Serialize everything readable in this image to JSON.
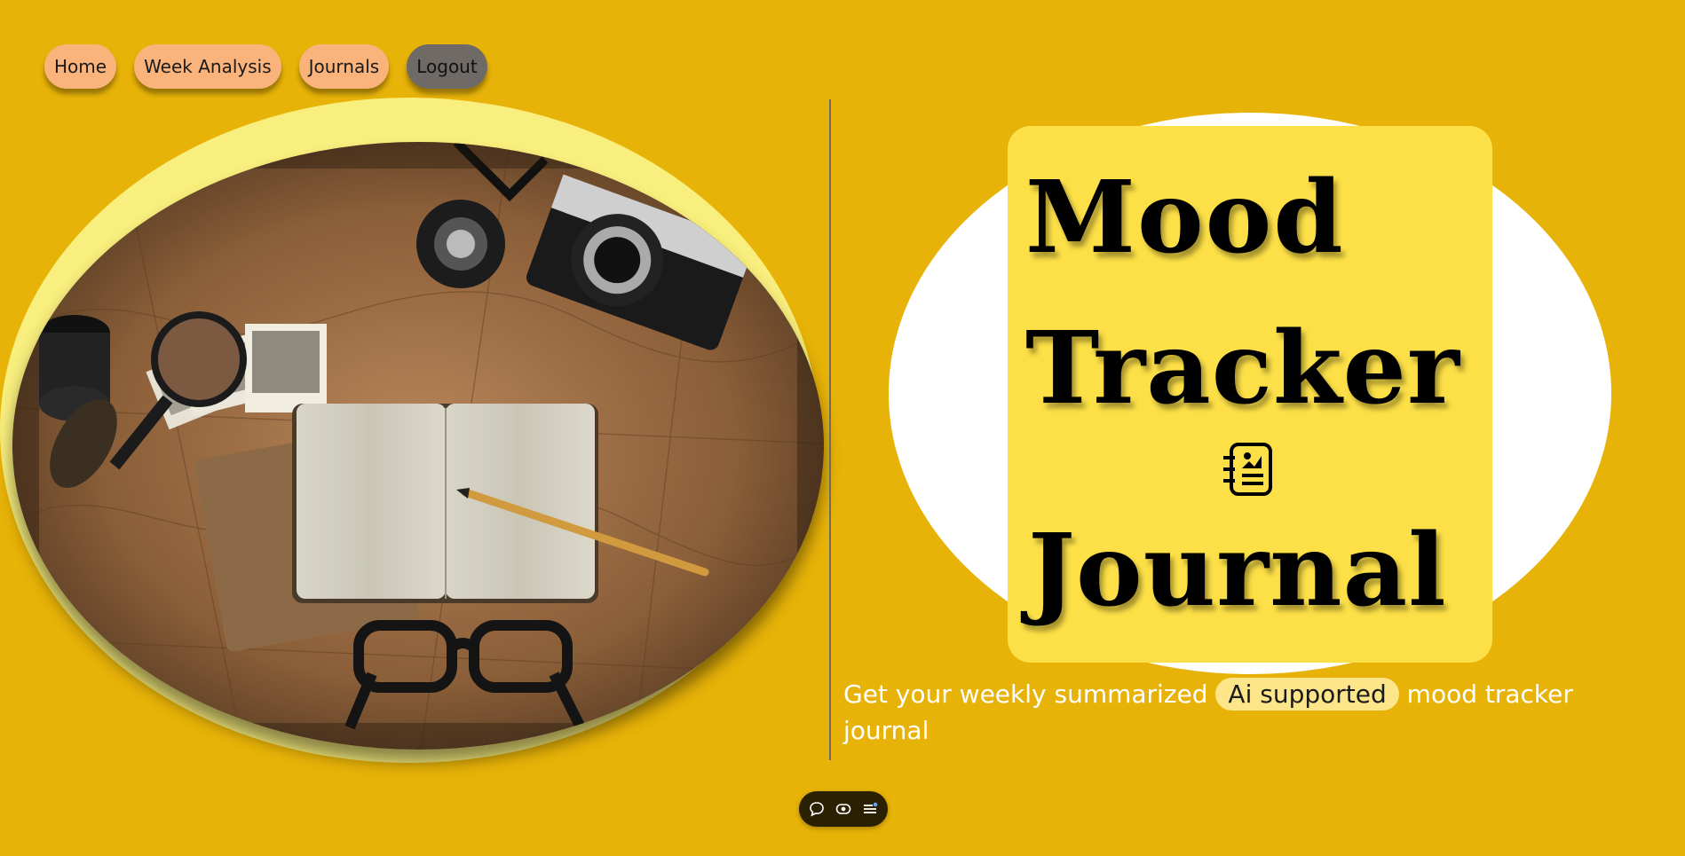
{
  "nav": {
    "items": [
      {
        "label": "Home"
      },
      {
        "label": "Week Analysis"
      },
      {
        "label": "Journals"
      },
      {
        "label": "Logout"
      }
    ]
  },
  "hero": {
    "line1": "Mood",
    "line2": "Tracker",
    "line3": "Journal",
    "icon": "journal-chart-icon"
  },
  "tagline": {
    "before": "Get your weekly summarized ",
    "highlight": "Ai supported",
    "after": " mood tracker journal"
  },
  "toolbar": {
    "icons": [
      "chat-icon",
      "eye-icon",
      "menu-icon"
    ]
  },
  "colors": {
    "background": "#e8b308",
    "nav_button": "#fab37a",
    "logout_button": "#6f6a66",
    "card": "#fde047",
    "highlight": "#fde68a",
    "oval": "#ffffff"
  }
}
